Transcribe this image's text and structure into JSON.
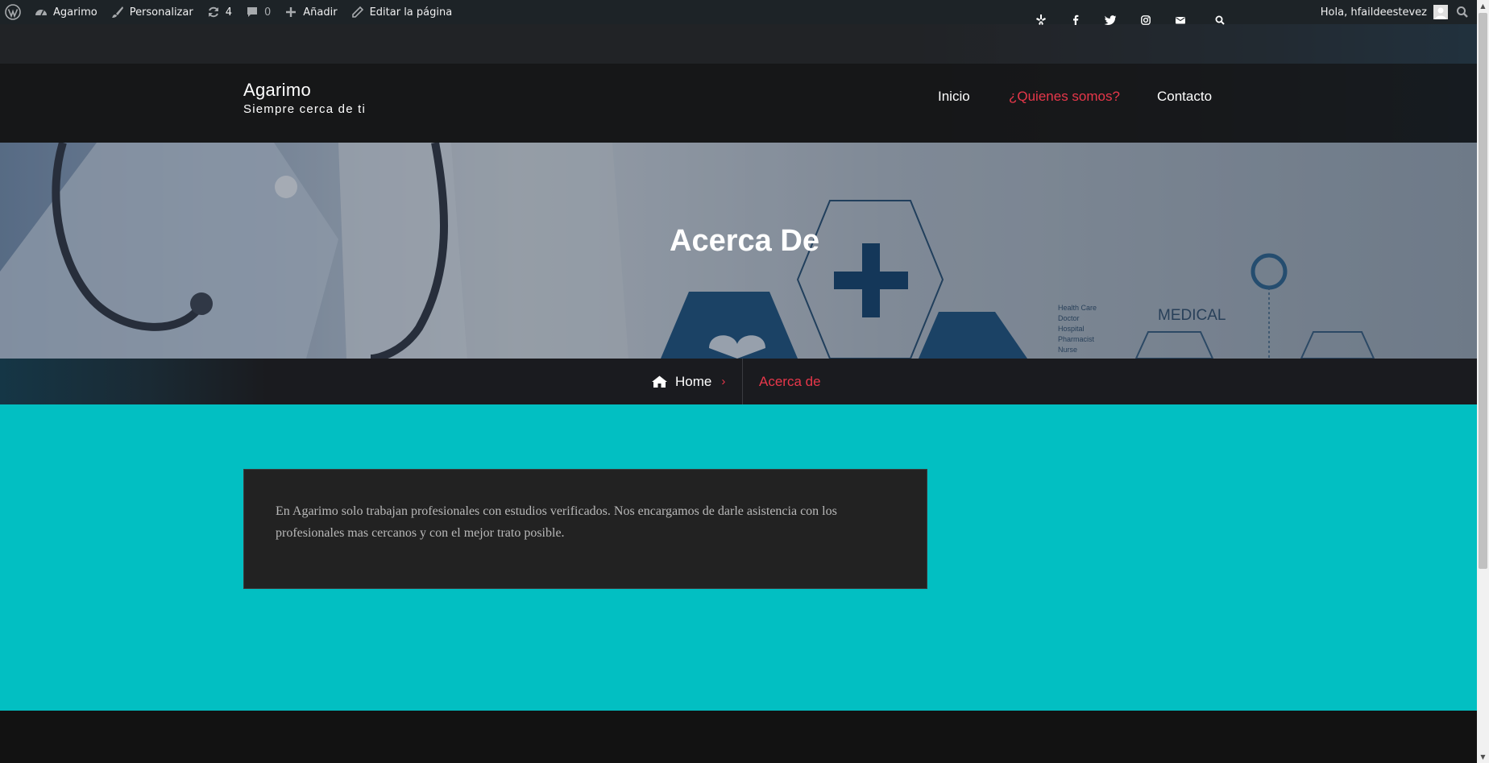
{
  "adminbar": {
    "wp_logo": "wordpress-icon",
    "site_name": "Agarimo",
    "customize": "Personalizar",
    "updates_count": "4",
    "comments_count": "0",
    "add_new": "Añadir",
    "edit_page": "Editar la página",
    "greeting": "Hola, hfaildeestevez"
  },
  "social": {
    "icons": [
      "yelp-icon",
      "facebook-icon",
      "twitter-icon",
      "instagram-icon",
      "envelope-icon",
      "search-icon"
    ]
  },
  "site": {
    "title": "Agarimo",
    "tagline": "Siempre cerca de ti"
  },
  "menu": {
    "items": [
      "Inicio",
      "¿Quienes somos?",
      "Contacto"
    ],
    "active_index": 1
  },
  "hero": {
    "title": "Acerca De",
    "bg_words": [
      "Health Care",
      "Doctor",
      "Hospital",
      "Pharmacist",
      "Nurse",
      "MEDICAL"
    ]
  },
  "breadcrumb": {
    "home": "Home",
    "separator": "›",
    "current": "Acerca de"
  },
  "content": {
    "text": "En Agarimo solo trabajan profesionales con estudios verificados. Nos encargamos de darle asistencia con los profesionales mas cercanos y con el mejor trato posible."
  },
  "colors": {
    "accent": "#e7374a",
    "teal": "#02bfc2",
    "dark": "#1a1b1e"
  }
}
